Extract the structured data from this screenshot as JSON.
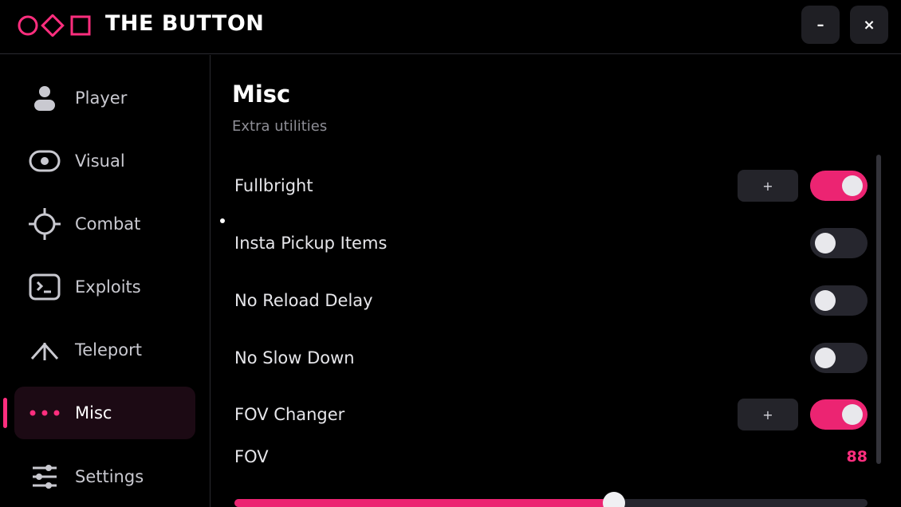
{
  "window": {
    "title": "THE BUTTON",
    "minimize_label": "–",
    "close_label": "×"
  },
  "colors": {
    "accent": "#ec2472",
    "accent_text": "#ff2e7e",
    "background": "#000000",
    "control_off": "#26262e"
  },
  "sidebar": {
    "active": "Misc",
    "items": [
      {
        "label": "Player",
        "icon": "user-icon"
      },
      {
        "label": "Visual",
        "icon": "eye-icon"
      },
      {
        "label": "Combat",
        "icon": "crosshair-icon"
      },
      {
        "label": "Exploits",
        "icon": "terminal-icon"
      },
      {
        "label": "Teleport",
        "icon": "teleport-arrow-icon"
      },
      {
        "label": "Misc",
        "icon": "dots-icon"
      },
      {
        "label": "Settings",
        "icon": "sliders-icon"
      }
    ]
  },
  "page": {
    "title": "Misc",
    "subtitle": "Extra utilities"
  },
  "settings": [
    {
      "label": "Fullbright",
      "keybind": "+",
      "enabled": true
    },
    {
      "label": "Insta Pickup Items",
      "enabled": false
    },
    {
      "label": "No Reload Delay",
      "enabled": false
    },
    {
      "label": "No Slow Down",
      "enabled": false
    },
    {
      "label": "FOV Changer",
      "keybind": "+",
      "enabled": true
    }
  ],
  "fov": {
    "label": "FOV",
    "value": "88",
    "fraction": 0.6
  }
}
